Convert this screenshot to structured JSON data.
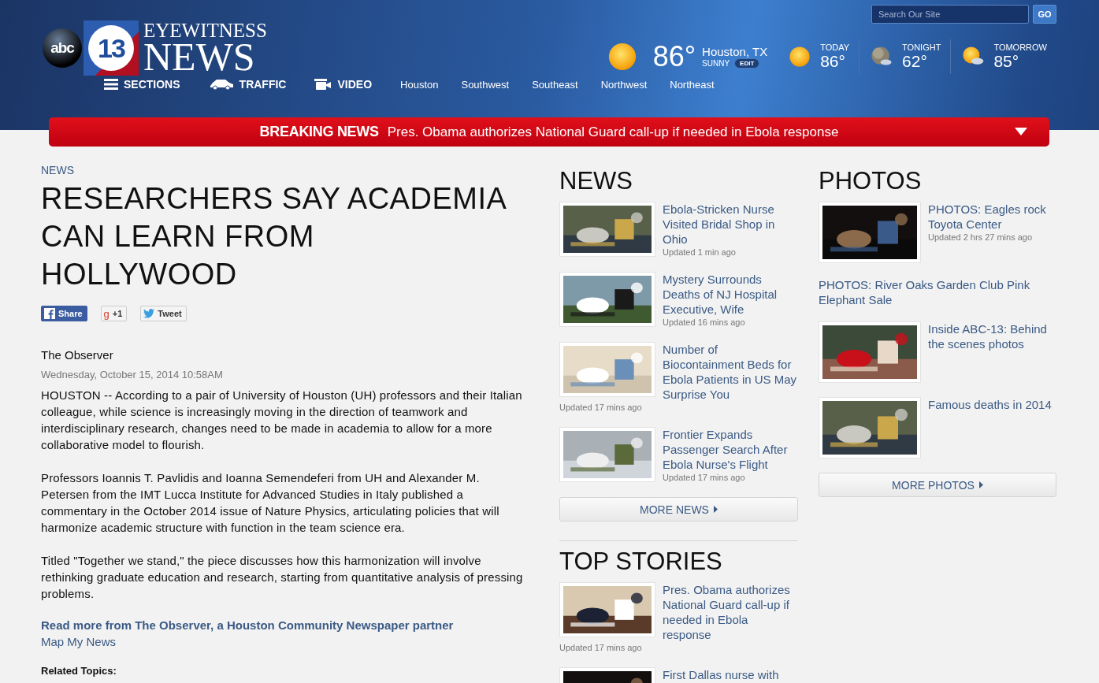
{
  "logo": {
    "network": "abc",
    "channel": "13",
    "line1": "EYEWITNESS",
    "line2": "NEWS"
  },
  "search": {
    "placeholder": "Search Our Site",
    "button": "GO"
  },
  "weather": {
    "temp": "86°",
    "city": "Houston, TX",
    "condition": "SUNNY",
    "edit": "EDIT",
    "forecast": [
      {
        "label": "TODAY",
        "temp": "86°",
        "kind": "sun"
      },
      {
        "label": "TONIGHT",
        "temp": "62°",
        "kind": "moon"
      },
      {
        "label": "TOMORROW",
        "temp": "85°",
        "kind": "partly"
      }
    ]
  },
  "main_nav": [
    {
      "label": "SECTIONS",
      "kind": "menu"
    },
    {
      "label": "TRAFFIC",
      "kind": "car"
    },
    {
      "label": "VIDEO",
      "kind": "camera"
    }
  ],
  "region_nav": [
    "Houston",
    "Southwest",
    "Southeast",
    "Northwest",
    "Northeast"
  ],
  "breaking": {
    "label": "BREAKING NEWS",
    "headline": "Pres. Obama authorizes National Guard call-up if needed in Ebola response"
  },
  "article": {
    "section": "NEWS",
    "title": "RESEARCHERS SAY ACADEMIA CAN LEARN FROM HOLLYWOOD",
    "share": [
      {
        "kind": "facebook",
        "label": "Share"
      },
      {
        "kind": "google",
        "glyph": "g",
        "label": "+1"
      },
      {
        "kind": "twitter",
        "label": "Tweet"
      }
    ],
    "source": "The Observer",
    "date": "Wednesday, October 15, 2014 10:58AM",
    "paragraphs": [
      "HOUSTON -- According to a pair of University of Houston (UH) professors and their Italian colleague, while science is increasingly moving in the direction of teamwork and interdisciplinary research, changes need to be made in academia to allow for a more collaborative model to flourish.",
      "Professors Ioannis T. Pavlidis and Ioanna Semendeferi from UH and Alexander M. Petersen from the IMT Lucca Institute for Advanced Studies in Italy published a commentary in the October 2014 issue of Nature Physics, articulating policies that will harmonize academic structure with function in the team science era.",
      "Titled \"Together we stand,\" the piece discusses how this harmonization will involve rethinking graduate education and research, starting from quantitative analysis of pressing problems."
    ],
    "read_more": "Read more from The Observer, a Houston Community Newspaper partner",
    "map_link": "Map My News",
    "related": "Related Topics:"
  },
  "news": {
    "heading": "NEWS",
    "items": [
      {
        "title": "Ebola-Stricken Nurse Visited Bridal Shop in Ohio",
        "updated": "Updated 1 min ago"
      },
      {
        "title": "Mystery Surrounds Deaths of NJ Hospital Executive, Wife",
        "updated": "Updated 16 mins ago"
      },
      {
        "title": "Number of Biocontainment Beds for Ebola Patients in US May Surprise You",
        "updated": "Updated 17 mins ago"
      },
      {
        "title": "Frontier Expands Passenger Search After Ebola Nurse's Flight",
        "updated": "Updated 17 mins ago"
      }
    ],
    "more": "MORE NEWS"
  },
  "top_stories": {
    "heading": "TOP STORIES",
    "items": [
      {
        "title": "Pres. Obama authorizes National Guard call-up if needed in Ebola response",
        "updated": "Updated 17 mins ago"
      },
      {
        "title": "First Dallas nurse with"
      }
    ]
  },
  "photos": {
    "heading": "PHOTOS",
    "items": [
      {
        "kind": "thumb",
        "title": "PHOTOS: Eagles rock Toyota Center",
        "updated": "Updated 2 hrs 27 mins ago"
      },
      {
        "kind": "text",
        "title": "PHOTOS: River Oaks Garden Club Pink Elephant Sale"
      },
      {
        "kind": "thumb",
        "title": "Inside ABC-13: Behind the scenes photos"
      },
      {
        "kind": "thumb",
        "title": "Famous deaths in 2014"
      }
    ],
    "more": "MORE PHOTOS"
  }
}
